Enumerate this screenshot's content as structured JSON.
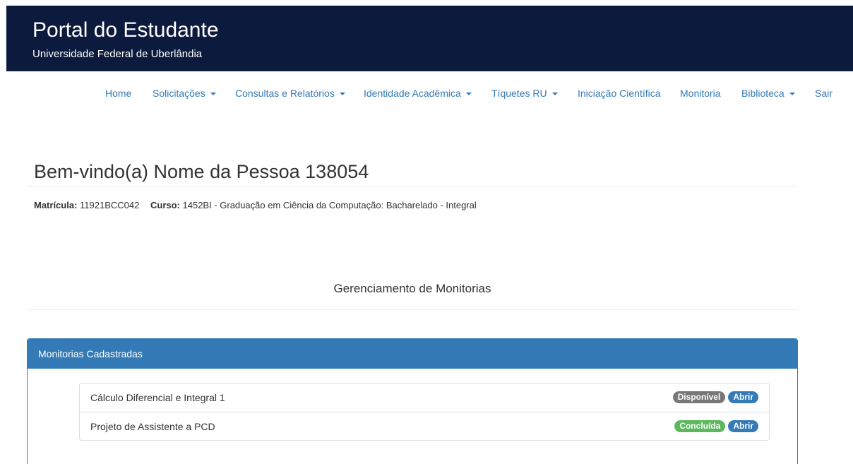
{
  "header": {
    "title": "Portal do Estudante",
    "subtitle": "Universidade Federal de Uberlândia",
    "background_color": "#0b1a3d"
  },
  "nav": {
    "items": [
      {
        "label": "Home",
        "dropdown": false
      },
      {
        "label": "Solicitações",
        "dropdown": true
      },
      {
        "label": "Consultas e Relatórios",
        "dropdown": true
      },
      {
        "label": "Identidade Acadêmica",
        "dropdown": true
      },
      {
        "label": "Tíquetes RU",
        "dropdown": true
      },
      {
        "label": "Iniciação Científica",
        "dropdown": false
      },
      {
        "label": "Monitoria",
        "dropdown": false
      },
      {
        "label": "Biblioteca",
        "dropdown": true
      },
      {
        "label": "Sair",
        "dropdown": false
      }
    ],
    "link_color": "#337ab7"
  },
  "welcome": "Bem-vindo(a) Nome da Pessoa 138054",
  "student": {
    "matricula_label": "Matrícula:",
    "matricula": "11921BCC042",
    "curso_label": "Curso:",
    "curso": "1452BI  - Graduação em Ciência da Computação: Bacharelado - Integral"
  },
  "section_title": "Gerenciamento de Monitorias",
  "panel": {
    "heading": "Monitorias Cadastradas",
    "accent_color": "#337ab7",
    "items": [
      {
        "name": "Cálculo Diferencial e Integral 1",
        "status": "Disponível",
        "status_color": "#777777",
        "action": "Abrir"
      },
      {
        "name": "Projeto de Assistente a PCD",
        "status": "Concluída",
        "status_color": "#5cb85c",
        "action": "Abrir"
      }
    ]
  }
}
